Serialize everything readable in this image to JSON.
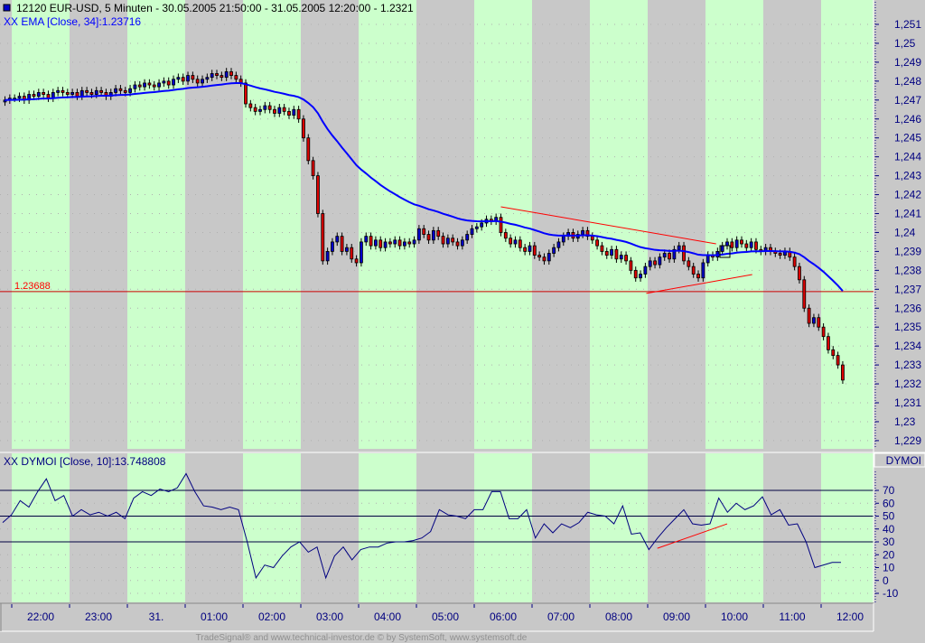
{
  "header": {
    "symbol_title": "12120  EUR-USD, 5 Minuten - 30.05.2005 21:50:00 - 31.05.2005 12:20:00 - 1.2321",
    "ema_label": "XX EMA [Close, 34]:1.23716",
    "dymoi_label": "XX DYMOI [Close, 10]:13.748808",
    "dymoi_axis_title": "DYMOI"
  },
  "footer": "TradeSignal® and www.technical-investor.de © by  SystemSoft, www.systemsoft.de",
  "colors": {
    "band_green": "#ccffcc",
    "band_gray": "#c8c8c8",
    "up": "#0000cc",
    "down": "#dd0000",
    "ema": "#0000ff",
    "trend": "#ff0000",
    "dymoi": "#000080"
  },
  "chart_data": [
    {
      "type": "candlestick",
      "title": "EUR-USD, 5 Minuten",
      "price_axis_ticks": [
        "1,251",
        "1,25",
        "1,249",
        "1,248",
        "1,247",
        "1,246",
        "1,245",
        "1,244",
        "1,243",
        "1,242",
        "1,241",
        "1,24",
        "1,239",
        "1,238",
        "1,237",
        "1,236",
        "1,235",
        "1,234",
        "1,233",
        "1,232",
        "1,231",
        "1,23",
        "1,229"
      ],
      "ylim": [
        1.229,
        1.251
      ],
      "time_labels": [
        "22:00",
        "23:00",
        "31.",
        "01:00",
        "02:00",
        "03:00",
        "04:00",
        "05:00",
        "06:00",
        "07:00",
        "08:00",
        "09:00",
        "10:00",
        "11:00",
        "12:00"
      ],
      "ema_period": 34,
      "horizontal_line": {
        "value": 1.23688,
        "label": "1.23688"
      },
      "trendlines": [
        {
          "from": [
            103,
            1.24136
          ],
          "to": [
            147.7,
            1.2394
          ]
        },
        {
          "from": [
            133.2,
            1.23678
          ],
          "to": [
            155.2,
            1.23778
          ]
        }
      ],
      "closes": [
        1.247,
        1.2471,
        1.2471,
        1.2472,
        1.247,
        1.2473,
        1.2472,
        1.2474,
        1.2473,
        1.2471,
        1.2474,
        1.2475,
        1.2474,
        1.2473,
        1.2474,
        1.2472,
        1.2475,
        1.2474,
        1.2473,
        1.2475,
        1.2474,
        1.2472,
        1.2474,
        1.2476,
        1.2475,
        1.2474,
        1.2476,
        1.2478,
        1.2477,
        1.2479,
        1.2478,
        1.2477,
        1.2479,
        1.248,
        1.2478,
        1.2481,
        1.2482,
        1.248,
        1.2483,
        1.2481,
        1.2479,
        1.2481,
        1.2482,
        1.2484,
        1.2483,
        1.2482,
        1.2485,
        1.2483,
        1.2481,
        1.2479,
        1.2468,
        1.2466,
        1.2464,
        1.2465,
        1.2467,
        1.2465,
        1.2463,
        1.2466,
        1.2464,
        1.2462,
        1.2465,
        1.246,
        1.245,
        1.2438,
        1.243,
        1.241,
        1.2385,
        1.239,
        1.2395,
        1.2398,
        1.239,
        1.2392,
        1.2386,
        1.2384,
        1.2395,
        1.2398,
        1.2393,
        1.2396,
        1.2392,
        1.2395,
        1.2394,
        1.2396,
        1.2393,
        1.2395,
        1.2394,
        1.2396,
        1.2402,
        1.2399,
        1.2396,
        1.2401,
        1.2398,
        1.2394,
        1.2397,
        1.2395,
        1.2393,
        1.2396,
        1.2399,
        1.2402,
        1.2403,
        1.2405,
        1.2407,
        1.2406,
        1.2408,
        1.24,
        1.2397,
        1.2394,
        1.2396,
        1.2392,
        1.239,
        1.2393,
        1.2388,
        1.2387,
        1.2385,
        1.2389,
        1.2392,
        1.2395,
        1.2398,
        1.24,
        1.2397,
        1.2399,
        1.2401,
        1.2398,
        1.2396,
        1.2393,
        1.239,
        1.2388,
        1.2391,
        1.2386,
        1.2388,
        1.2385,
        1.238,
        1.2376,
        1.2378,
        1.2382,
        1.2385,
        1.2383,
        1.2387,
        1.2389,
        1.2386,
        1.2391,
        1.2393,
        1.2385,
        1.2382,
        1.2378,
        1.2376,
        1.2384,
        1.2388,
        1.2387,
        1.239,
        1.2393,
        1.2395,
        1.2392,
        1.2396,
        1.2394,
        1.2392,
        1.2395,
        1.2391,
        1.239,
        1.2392,
        1.239,
        1.2389,
        1.2388,
        1.239,
        1.2387,
        1.2382,
        1.2375,
        1.236,
        1.2352,
        1.2355,
        1.235,
        1.2345,
        1.2338,
        1.2335,
        1.233,
        1.2322
      ]
    },
    {
      "type": "line",
      "title": "DYMOI [Close, 10]",
      "axis_ticks": [
        "70",
        "60",
        "50",
        "40",
        "30",
        "20",
        "10",
        "0",
        "-10"
      ],
      "ylim": [
        -10,
        70
      ],
      "reference_lines": [
        70,
        50,
        30
      ],
      "trendline": {
        "from": [
          135.5,
          25
        ],
        "to": [
          150,
          44
        ]
      },
      "values": [
        45,
        51,
        62,
        57,
        69,
        79,
        62,
        66,
        50,
        55,
        51,
        53,
        50,
        53,
        48,
        64,
        69,
        66,
        71,
        69,
        72,
        83,
        69,
        58,
        57,
        55,
        57,
        55,
        30,
        2,
        12,
        10,
        19,
        26,
        30,
        22,
        26,
        2,
        19,
        26,
        16,
        24,
        26,
        26,
        29,
        30,
        30,
        31,
        33,
        38,
        55,
        51,
        50,
        48,
        55,
        55,
        69,
        69,
        48,
        48,
        55,
        33,
        44,
        37,
        44,
        41,
        45,
        53,
        51,
        50,
        44,
        58,
        36,
        37,
        24,
        33,
        41,
        48,
        55,
        44,
        43,
        44,
        64,
        53,
        60,
        55,
        58,
        65,
        51,
        55,
        43,
        44,
        30,
        10,
        12,
        14,
        14
      ]
    }
  ]
}
